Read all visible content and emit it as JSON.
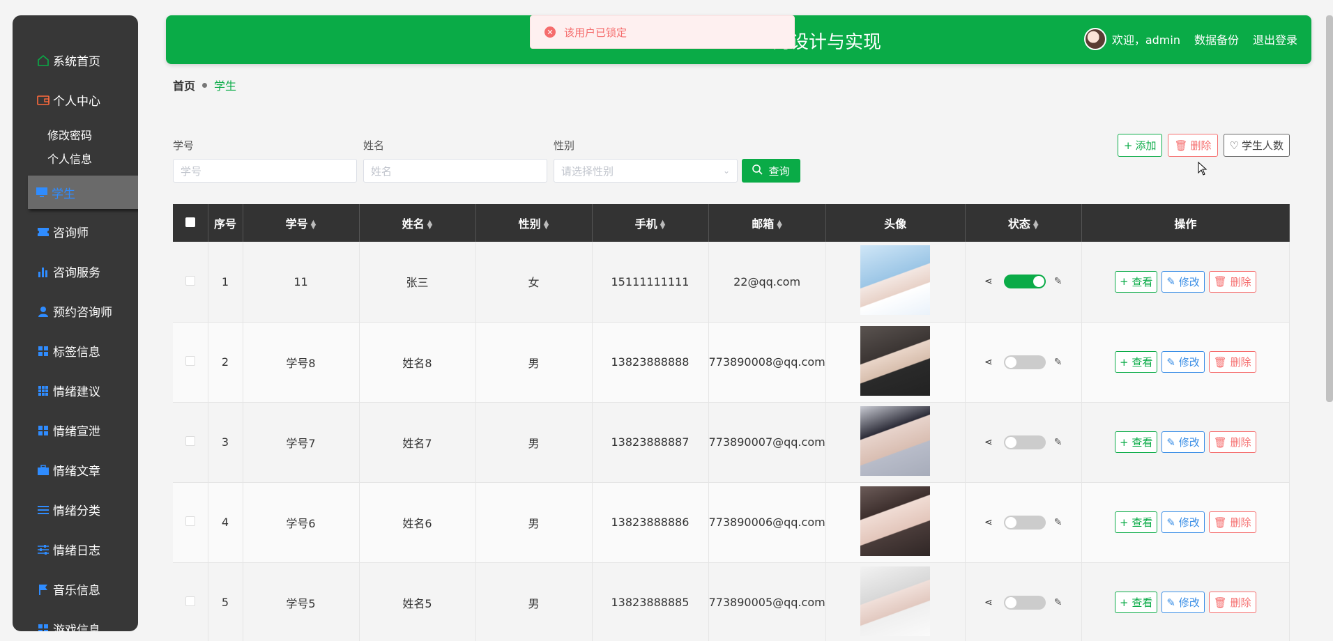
{
  "sidebar": {
    "items": [
      {
        "label": "系统首页",
        "icon": "home-icon",
        "color": "#0aab47"
      },
      {
        "label": "个人中心",
        "icon": "wallet-icon",
        "color": "#ff6a3d"
      },
      {
        "label": "修改密码",
        "sub": true
      },
      {
        "label": "个人信息",
        "sub": true
      },
      {
        "label": "学生",
        "icon": "monitor-icon",
        "active": true
      },
      {
        "label": "咨询师",
        "icon": "ticket-icon"
      },
      {
        "label": "咨询服务",
        "icon": "bar-chart-icon"
      },
      {
        "label": "预约咨询师",
        "icon": "user-icon"
      },
      {
        "label": "标签信息",
        "icon": "grid-icon"
      },
      {
        "label": "情绪建议",
        "icon": "apps-icon"
      },
      {
        "label": "情绪宣泄",
        "icon": "grid-icon"
      },
      {
        "label": "情绪文章",
        "icon": "briefcase-icon"
      },
      {
        "label": "情绪分类",
        "icon": "list-icon"
      },
      {
        "label": "情绪日志",
        "icon": "sliders-icon"
      },
      {
        "label": "音乐信息",
        "icon": "flag-icon"
      },
      {
        "label": "游戏信息",
        "icon": "grid-icon"
      }
    ]
  },
  "header": {
    "title": "的设计与实现",
    "welcome": "欢迎，admin",
    "backup": "数据备份",
    "logout": "退出登录"
  },
  "toast": {
    "message": "该用户已锁定"
  },
  "breadcrumb": {
    "home": "首页",
    "current": "学生"
  },
  "search": {
    "xuehao_label": "学号",
    "xuehao_placeholder": "学号",
    "name_label": "姓名",
    "name_placeholder": "姓名",
    "gender_label": "性别",
    "gender_placeholder": "请选择性别",
    "query_button": "查询"
  },
  "actions": {
    "add": "添加",
    "delete": "删除",
    "count": "学生人数"
  },
  "table": {
    "headers": [
      "序号",
      "学号",
      "姓名",
      "性别",
      "手机",
      "邮箱",
      "头像",
      "状态",
      "操作"
    ],
    "rows": [
      {
        "idx": "1",
        "xuehao": "11",
        "name": "张三",
        "gender": "女",
        "phone": "15111111111",
        "email": "22@qq.com",
        "on": true
      },
      {
        "idx": "2",
        "xuehao": "学号8",
        "name": "姓名8",
        "gender": "男",
        "phone": "13823888888",
        "email": "773890008@qq.com",
        "on": false
      },
      {
        "idx": "3",
        "xuehao": "学号7",
        "name": "姓名7",
        "gender": "男",
        "phone": "13823888887",
        "email": "773890007@qq.com",
        "on": false
      },
      {
        "idx": "4",
        "xuehao": "学号6",
        "name": "姓名6",
        "gender": "男",
        "phone": "13823888886",
        "email": "773890006@qq.com",
        "on": false
      },
      {
        "idx": "5",
        "xuehao": "学号5",
        "name": "姓名5",
        "gender": "男",
        "phone": "13823888885",
        "email": "773890005@qq.com",
        "on": false
      }
    ],
    "ops": {
      "view": "查看",
      "edit": "修改",
      "delete": "删除"
    }
  },
  "colors": {
    "primary": "#0aab47",
    "danger": "#f56c6c",
    "info": "#3a8ee6",
    "sidebar": "#373737"
  }
}
